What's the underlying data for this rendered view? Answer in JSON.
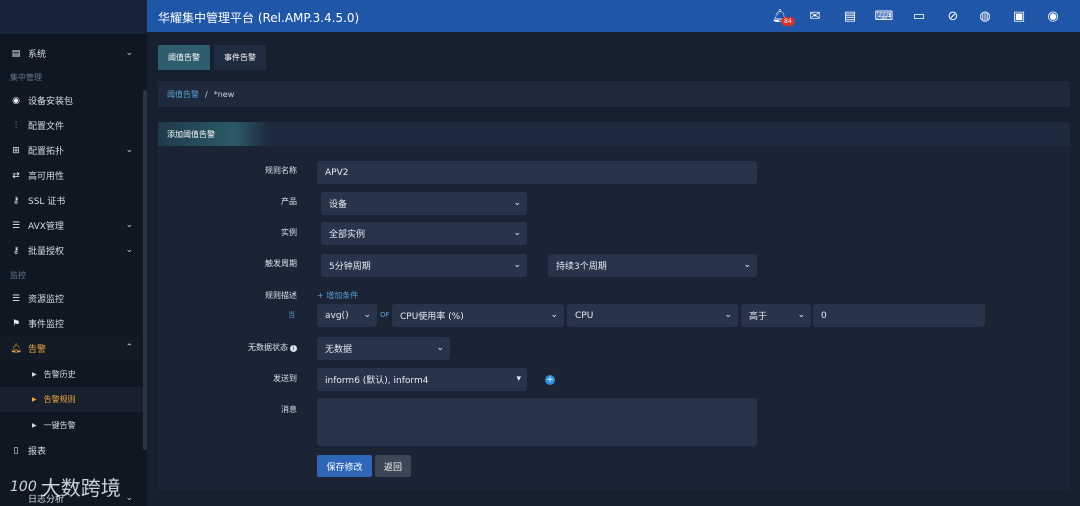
{
  "app": {
    "title": "华耀集中管理平台 (Rel.AMP.3.4.5.0)"
  },
  "topbar": {
    "icons": [
      "bell-icon",
      "mail-icon",
      "document-icon",
      "terminal-icon",
      "monitor-icon",
      "compass-icon",
      "globe-icon",
      "save-icon",
      "user-icon"
    ],
    "badge": "84"
  },
  "sidebar": {
    "items_top": [
      {
        "label": "系统",
        "icon": "book-icon",
        "chevron": "⌄"
      }
    ],
    "group_manage": "集中管理",
    "manage_items": [
      {
        "label": "设备安装包",
        "icon": "disc-icon"
      },
      {
        "label": "配置文件",
        "icon": "sliders-icon"
      },
      {
        "label": "配置拓扑",
        "icon": "sitemap-icon",
        "chevron": "⌄"
      },
      {
        "label": "高可用性",
        "icon": "exchange-icon"
      },
      {
        "label": "SSL 证书",
        "icon": "key-icon"
      },
      {
        "label": "AVX管理",
        "icon": "list-icon",
        "chevron": "⌄"
      },
      {
        "label": "批量授权",
        "icon": "key-icon",
        "chevron": "⌄"
      }
    ],
    "group_monitor": "监控",
    "monitor_items": [
      {
        "label": "资源监控",
        "icon": "list-icon"
      },
      {
        "label": "事件监控",
        "icon": "flag-icon"
      }
    ],
    "alert_item": {
      "label": "告警",
      "icon": "bell-icon",
      "chevron": "⌃"
    },
    "alert_sub": [
      {
        "label": "告警历史"
      },
      {
        "label": "告警规则"
      },
      {
        "label": "一键告警"
      }
    ],
    "report_item": {
      "label": "报表",
      "icon": "file-icon"
    },
    "log_item": {
      "label": "日志分析",
      "chevron": "⌄"
    }
  },
  "tabs": [
    {
      "label": "阈值告警",
      "active": true
    },
    {
      "label": "事件告警",
      "active": false
    }
  ],
  "breadcrumb": {
    "link": "阈值告警",
    "sep": "/",
    "current": "*new"
  },
  "panel": {
    "title": "添加阈值告警"
  },
  "form": {
    "rule_name_label": "规则名称",
    "rule_name_value": "APV2",
    "product_label": "产品",
    "product_value": "设备",
    "instance_label": "实例",
    "instance_value": "全部实例",
    "trigger_label": "触发周期",
    "trigger_value": "5分钟周期",
    "trigger_duration": "持续3个周期",
    "desc_label": "规则描述",
    "add_condition": "+ 增加条件",
    "when": "当",
    "agg_value": "avg()",
    "of_text": "OF",
    "metric_value": "CPU使用率 (%)",
    "target_value": "CPU",
    "compare_value": "高于",
    "threshold_value": "0",
    "nodata_label": "无数据状态",
    "nodata_value": "无数据",
    "sendto_label": "发送到",
    "sendto_value": "inform6 (默认), inform4",
    "message_label": "消息",
    "message_value": ""
  },
  "buttons": {
    "save": "保存修改",
    "back": "返回"
  },
  "watermark": {
    "logo": "100",
    "text": "大数跨境"
  }
}
